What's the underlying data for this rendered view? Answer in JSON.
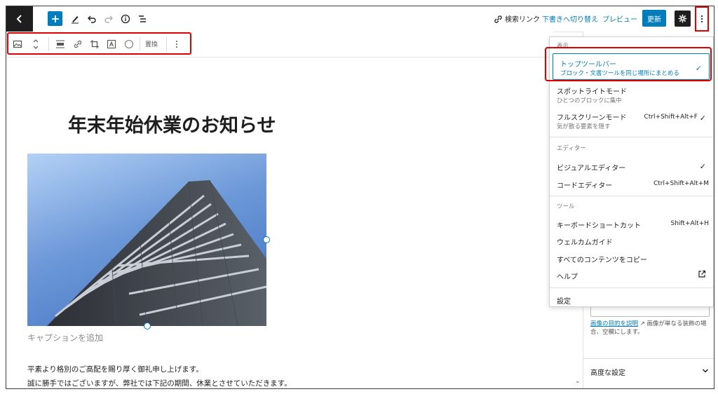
{
  "topbar": {
    "search_link": "検索リンク",
    "draft_link": "下書きへ切り替え",
    "preview_link": "プレビュー",
    "update_label": "更新",
    "icons": [
      "back-icon",
      "plus-icon",
      "pen-icon",
      "undo-icon",
      "redo-icon",
      "info-icon",
      "list-view-icon",
      "link-icon",
      "gear-icon",
      "more-vertical-icon"
    ]
  },
  "block_toolbar": {
    "replace_label": "置換",
    "icons": [
      "image-icon",
      "move-arrows-icon",
      "align-icon",
      "link-icon",
      "crop-icon",
      "text-overlay-icon",
      "circle-icon",
      "more-vertical-icon"
    ]
  },
  "content": {
    "title": "年末年始休業のお知らせ",
    "caption_placeholder": "キャプションを追加",
    "paragraphs": [
      "平素より格別のご高配を賜り厚く御礼申し上げます。",
      "誠に勝手ではございますが、弊社では下記の期間、休業とさせていただきます。"
    ]
  },
  "sidebar": {
    "alt_help_link": "画像の目的を説明",
    "alt_help_text": "画像が単なる装飾の場合、空欄にします。",
    "advanced_label": "高度な設定"
  },
  "menu": {
    "view_label": "表示",
    "view_items": [
      {
        "label": "トップツールバー",
        "desc": "ブロック・文書ツールを同じ場所にまとめる",
        "check": "✓"
      },
      {
        "label": "スポットライトモード",
        "desc": "ひとつのブロックに集中",
        "check": ""
      },
      {
        "label": "フルスクリーンモード",
        "desc": "気が散る要素を隠す",
        "shortcut": "Ctrl+Shift+Alt+F",
        "check": "✓"
      }
    ],
    "editor_label": "エディター",
    "editor_items": [
      {
        "label": "ビジュアルエディター",
        "check": "✓",
        "shortcut": ""
      },
      {
        "label": "コードエディター",
        "check": "",
        "shortcut": "Ctrl+Shift+Alt+M"
      }
    ],
    "tools_label": "ツール",
    "tool_items": [
      {
        "label": "キーボードショートカット",
        "shortcut": "Shift+Alt+H"
      },
      {
        "label": "ウェルカムガイド",
        "shortcut": ""
      },
      {
        "label": "すべてのコンテンツをコピー",
        "shortcut": ""
      },
      {
        "label": "ヘルプ",
        "shortcut": ""
      }
    ],
    "settings_label": "設定"
  },
  "colors": {
    "accent": "#007cba",
    "highlight": "#e00000",
    "dark": "#1e1e1e"
  }
}
